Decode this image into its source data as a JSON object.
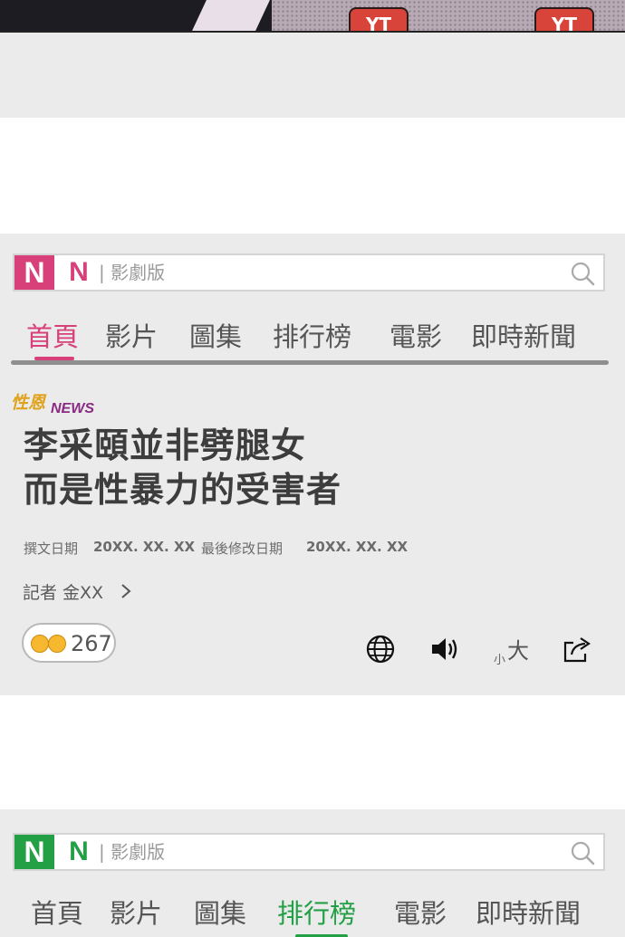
{
  "comic": {
    "badge_text": "YT"
  },
  "article_panel": {
    "search": {
      "logo_brand": "N",
      "logo_secondary": "N",
      "section": "| 影劇版",
      "logo_color": "#d8407a"
    },
    "tabs": [
      {
        "label": "首頁",
        "active": true
      },
      {
        "label": "影片",
        "active": false
      },
      {
        "label": "圖集",
        "active": false
      },
      {
        "label": "排行榜",
        "active": false
      },
      {
        "label": "電影",
        "active": false
      },
      {
        "label": "即時新聞",
        "active": false
      }
    ],
    "active_color": "#d8407a",
    "brand_tag": "性恩",
    "brand_news": "NEWS",
    "headline_line1": "李采頤並非劈腿女",
    "headline_line2": "而是性暴力的受害者",
    "written_label": "撰文日期",
    "written_date": "20XX. XX. XX",
    "modified_label": "最後修改日期",
    "modified_date": "20XX. XX. XX",
    "reporter": "記者  金XX",
    "reaction_count": "267",
    "font_size_small": "小",
    "font_size_large": "大",
    "icons": [
      "globe-icon",
      "speaker-icon",
      "font-size-icon",
      "share-icon"
    ]
  },
  "second_panel": {
    "search": {
      "logo_brand": "N",
      "logo_secondary": "N",
      "section": "| 影劇版",
      "logo_color": "#23a046"
    },
    "tabs": [
      {
        "label": "首頁",
        "active": false
      },
      {
        "label": "影片",
        "active": false
      },
      {
        "label": "圖集",
        "active": false
      },
      {
        "label": "排行榜",
        "active": true
      },
      {
        "label": "電影",
        "active": false
      },
      {
        "label": "即時新聞",
        "active": false
      }
    ],
    "active_color": "#23a046"
  }
}
